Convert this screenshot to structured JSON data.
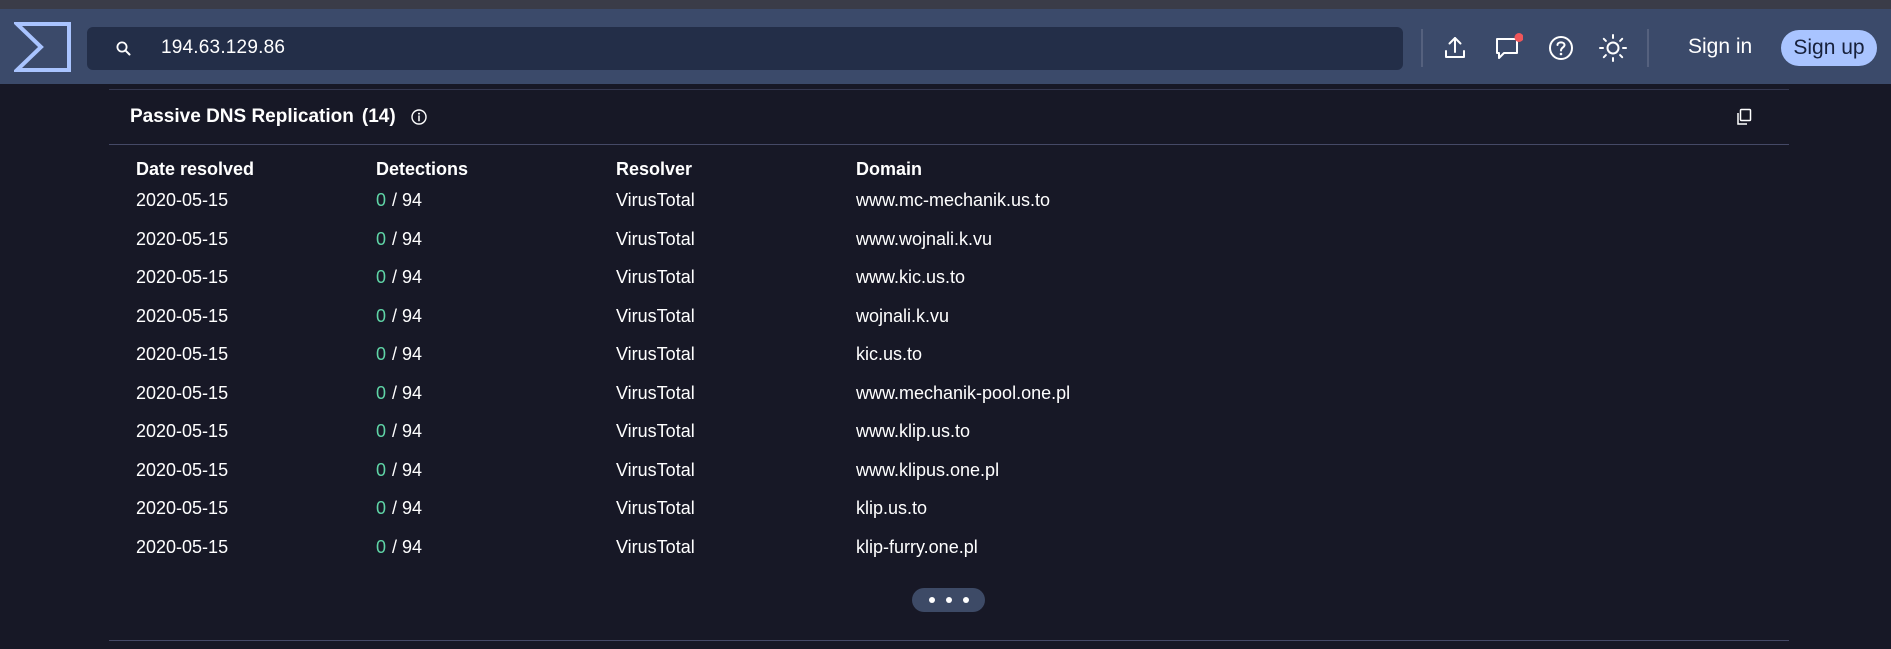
{
  "search": {
    "value": "194.63.129.86"
  },
  "header": {
    "signin_label": "Sign in",
    "signup_label": "Sign up",
    "notification_dot_color": "#f0565a",
    "accent_color": "#a9c4ff"
  },
  "icons": {
    "logo": "virustotal-logo",
    "search": "search-icon",
    "upload": "upload-icon",
    "chat": "chat-icon",
    "help": "help-icon",
    "theme": "sun-icon",
    "info": "info-icon",
    "copy": "copy-icon"
  },
  "panel": {
    "title": "Passive DNS Replication",
    "count": "(14)",
    "columns": [
      "Date resolved",
      "Detections",
      "Resolver",
      "Domain"
    ],
    "rows": [
      {
        "date": "2020-05-15",
        "det_positive": "0",
        "det_total": "/ 94",
        "resolver": "VirusTotal",
        "domain": "www.mc-mechanik.us.to"
      },
      {
        "date": "2020-05-15",
        "det_positive": "0",
        "det_total": "/ 94",
        "resolver": "VirusTotal",
        "domain": "www.wojnali.k.vu"
      },
      {
        "date": "2020-05-15",
        "det_positive": "0",
        "det_total": "/ 94",
        "resolver": "VirusTotal",
        "domain": "www.kic.us.to"
      },
      {
        "date": "2020-05-15",
        "det_positive": "0",
        "det_total": "/ 94",
        "resolver": "VirusTotal",
        "domain": "wojnali.k.vu"
      },
      {
        "date": "2020-05-15",
        "det_positive": "0",
        "det_total": "/ 94",
        "resolver": "VirusTotal",
        "domain": "kic.us.to"
      },
      {
        "date": "2020-05-15",
        "det_positive": "0",
        "det_total": "/ 94",
        "resolver": "VirusTotal",
        "domain": "www.mechanik-pool.one.pl"
      },
      {
        "date": "2020-05-15",
        "det_positive": "0",
        "det_total": "/ 94",
        "resolver": "VirusTotal",
        "domain": "www.klip.us.to"
      },
      {
        "date": "2020-05-15",
        "det_positive": "0",
        "det_total": "/ 94",
        "resolver": "VirusTotal",
        "domain": "www.klipus.one.pl"
      },
      {
        "date": "2020-05-15",
        "det_positive": "0",
        "det_total": "/ 94",
        "resolver": "VirusTotal",
        "domain": "klip.us.to"
      },
      {
        "date": "2020-05-15",
        "det_positive": "0",
        "det_total": "/ 94",
        "resolver": "VirusTotal",
        "domain": "klip-furry.one.pl"
      }
    ],
    "zero_detection_color": "#5fd4a6"
  }
}
